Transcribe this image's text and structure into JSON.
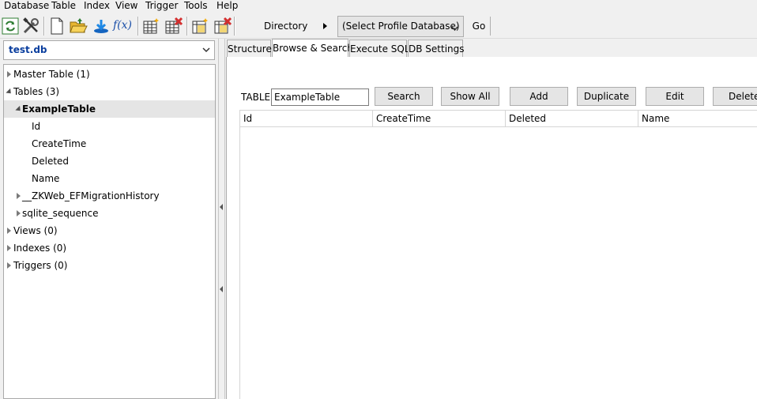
{
  "menubar": {
    "items": [
      {
        "label": "Database"
      },
      {
        "label": "Table"
      },
      {
        "label": "Index"
      },
      {
        "label": "View"
      },
      {
        "label": "Trigger"
      },
      {
        "label": "Tools"
      },
      {
        "label": "Help"
      }
    ]
  },
  "toolbar": {
    "directory_label": "Directory",
    "profile_select": "(Select Profile Database)",
    "go_label": "Go",
    "fx_label": "f(x)"
  },
  "sidebar": {
    "database": "test.db",
    "tree": {
      "master_table": "Master Table (1)",
      "tables": "Tables (3)",
      "example_table": "ExampleTable",
      "columns": [
        "Id",
        "CreateTime",
        "Deleted",
        "Name"
      ],
      "migration_history": "__ZKWeb_EFMigrationHistory",
      "sqlite_sequence": "sqlite_sequence",
      "views": "Views (0)",
      "indexes": "Indexes (0)",
      "triggers": "Triggers (0)"
    }
  },
  "tabs": [
    {
      "label": "Structure"
    },
    {
      "label": "Browse & Search"
    },
    {
      "label": "Execute SQL"
    },
    {
      "label": "DB Settings"
    }
  ],
  "browse": {
    "table_label": "TABLE",
    "table_value": "ExampleTable",
    "search": "Search",
    "show_all": "Show All",
    "add": "Add",
    "duplicate": "Duplicate",
    "edit": "Edit",
    "delete": "Delete",
    "columns": [
      "Id",
      "CreateTime",
      "Deleted",
      "Name"
    ]
  },
  "colors": {
    "accent": "#0a3e9e",
    "selection": "#e5e5e5"
  }
}
